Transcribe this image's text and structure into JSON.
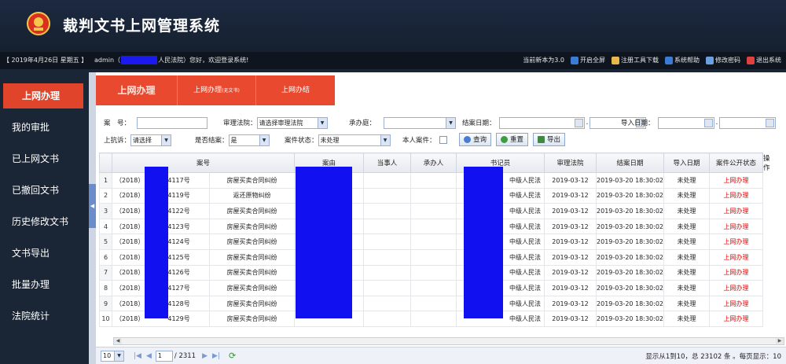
{
  "app": {
    "title": "裁判文书上网管理系统"
  },
  "infobar": {
    "date": "【 2019年4月26日  星期五 】",
    "admin_prefix": "admin（",
    "admin_suffix": "人民法院）您好，欢迎登录系统!",
    "version": "当前新本为3.0",
    "links": [
      {
        "label": "开启全屏",
        "icon": "fullscreen-icon",
        "color": "#3a7bd5"
      },
      {
        "label": "注册工具下载",
        "icon": "download-icon",
        "color": "#e8b84a"
      },
      {
        "label": "系统帮助",
        "icon": "help-icon",
        "color": "#3a7bd5"
      },
      {
        "label": "修改密码",
        "icon": "password-icon",
        "color": "#6aa0e0"
      },
      {
        "label": "退出系统",
        "icon": "logout-icon",
        "color": "#e04040"
      }
    ]
  },
  "sidebar": {
    "items": [
      {
        "label": "上网办理"
      },
      {
        "label": "我的审批"
      },
      {
        "label": "已上网文书"
      },
      {
        "label": "已撤回文书"
      },
      {
        "label": "历史修改文书"
      },
      {
        "label": "文书导出"
      },
      {
        "label": "批量办理"
      },
      {
        "label": "法院统计"
      }
    ]
  },
  "tabs": {
    "t1": "上网办理",
    "t2": "上网办理",
    "t2_sub": "(无文书)",
    "t3": "上网办结"
  },
  "filters": {
    "case_no_label": "案　号：",
    "court_label": "审理法院：",
    "court_value": "请选择审理法院",
    "undertaker_label": "承办庭：",
    "close_date_label": "结案日期：",
    "import_date_label": "导入日期：",
    "appeal_label": "上抗诉：",
    "appeal_value": "请选择",
    "closed_label": "是否结案：",
    "closed_value": "是",
    "status_label": "案件状态：",
    "status_value": "未处理",
    "mine_label": "本人案件：",
    "query_btn": "查询",
    "reset_btn": "重置",
    "export_btn": "导出"
  },
  "table": {
    "headers": [
      "案号",
      "案由",
      "当事人",
      "承办人",
      "书记员",
      "审理法院",
      "结案日期",
      "导入日期",
      "案件公开状态",
      "操作"
    ],
    "rows": [
      {
        "n": "1",
        "case": "（2018）",
        "num": "4117号",
        "cause": "房屋买卖合同纠纷",
        "court": "中级人民法",
        "close": "2019-03-12",
        "imp": "2019-03-20 18:30:02",
        "status": "未处理",
        "op": "上网办理"
      },
      {
        "n": "2",
        "case": "（2018）",
        "num": "4119号",
        "cause": "返还原物纠纷",
        "court": "中级人民法",
        "close": "2019-03-12",
        "imp": "2019-03-20 18:30:02",
        "status": "未处理",
        "op": "上网办理"
      },
      {
        "n": "3",
        "case": "（2018）",
        "num": "4122号",
        "cause": "房屋买卖合同纠纷",
        "court": "中级人民法",
        "close": "2019-03-12",
        "imp": "2019-03-20 18:30:02",
        "status": "未处理",
        "op": "上网办理"
      },
      {
        "n": "4",
        "case": "（2018）",
        "num": "4123号",
        "cause": "房屋买卖合同纠纷",
        "court": "中级人民法",
        "close": "2019-03-12",
        "imp": "2019-03-20 18:30:02",
        "status": "未处理",
        "op": "上网办理"
      },
      {
        "n": "5",
        "case": "（2018）",
        "num": "4124号",
        "cause": "房屋买卖合同纠纷",
        "court": "中级人民法",
        "close": "2019-03-12",
        "imp": "2019-03-20 18:30:02",
        "status": "未处理",
        "op": "上网办理"
      },
      {
        "n": "6",
        "case": "（2018）",
        "num": "4125号",
        "cause": "房屋买卖合同纠纷",
        "court": "中级人民法",
        "close": "2019-03-12",
        "imp": "2019-03-20 18:30:02",
        "status": "未处理",
        "op": "上网办理"
      },
      {
        "n": "7",
        "case": "（2018）",
        "num": "4126号",
        "cause": "房屋买卖合同纠纷",
        "court": "中级人民法",
        "close": "2019-03-12",
        "imp": "2019-03-20 18:30:02",
        "status": "未处理",
        "op": "上网办理"
      },
      {
        "n": "8",
        "case": "（2018）",
        "num": "4127号",
        "cause": "房屋买卖合同纠纷",
        "court": "中级人民法",
        "close": "2019-03-12",
        "imp": "2019-03-20 18:30:02",
        "status": "未处理",
        "op": "上网办理"
      },
      {
        "n": "9",
        "case": "（2018）",
        "num": "4128号",
        "cause": "房屋买卖合同纠纷",
        "court": "中级人民法",
        "close": "2019-03-12",
        "imp": "2019-03-20 18:30:02",
        "status": "未处理",
        "op": "上网办理"
      },
      {
        "n": "10",
        "case": "（2018）",
        "num": "4129号",
        "cause": "房屋买卖合同纠纷",
        "court": "中级人民法",
        "close": "2019-03-12",
        "imp": "2019-03-20 18:30:02",
        "status": "未处理",
        "op": "上网办理"
      }
    ]
  },
  "pager": {
    "page_size": "10",
    "page": "1",
    "total_pages": "/ 2311",
    "info": "显示从1到10，总 23102 条 。每页显示：10"
  }
}
